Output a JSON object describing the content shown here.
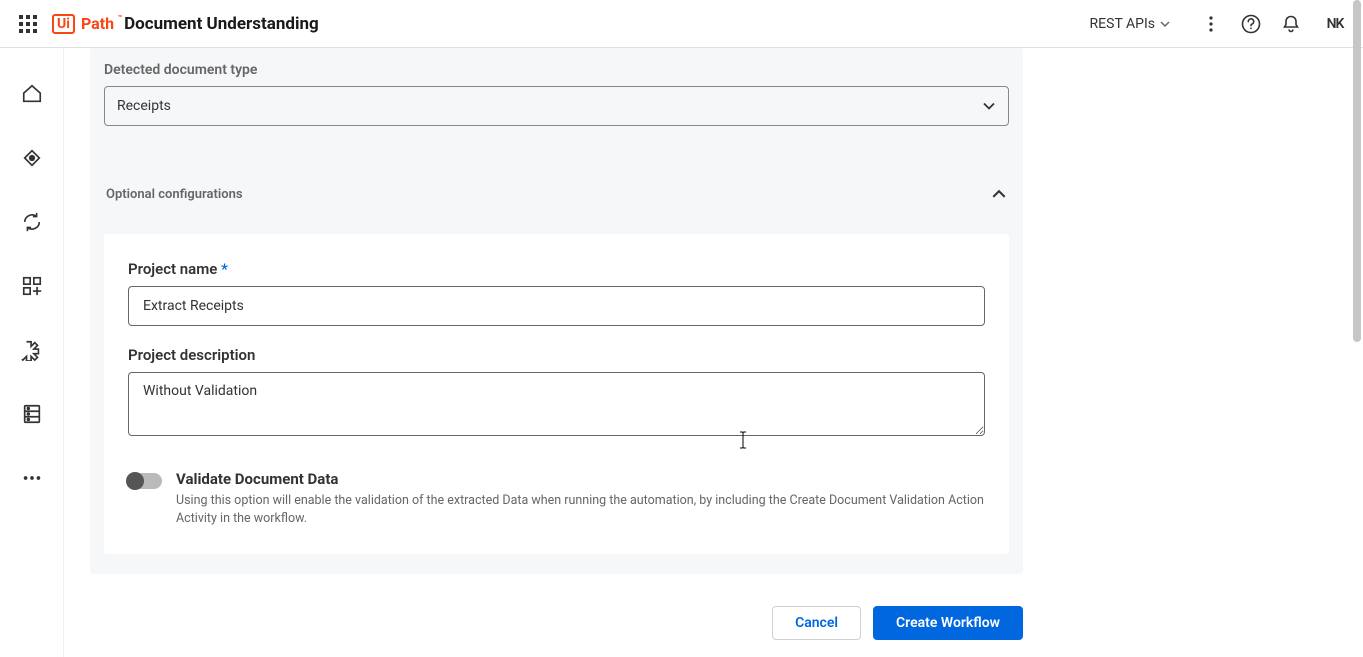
{
  "header": {
    "logo_ui": "Ui",
    "logo_path": "Path",
    "app_title": "Document Understanding",
    "rest_api_label": "REST APIs",
    "avatar_initials": "NK"
  },
  "form": {
    "detected_doc_type_label": "Detected document type",
    "detected_doc_type_value": "Receipts",
    "optional_config_label": "Optional configurations",
    "project_name_label": "Project name",
    "project_name_required": "*",
    "project_name_value": "Extract Receipts",
    "project_desc_label": "Project description",
    "project_desc_value": "Without Validation",
    "validate_title": "Validate Document Data",
    "validate_desc": "Using this option will enable the validation of the extracted Data when running the automation, by including the Create Document Validation Action Activity in the workflow."
  },
  "buttons": {
    "cancel": "Cancel",
    "create": "Create Workflow"
  }
}
